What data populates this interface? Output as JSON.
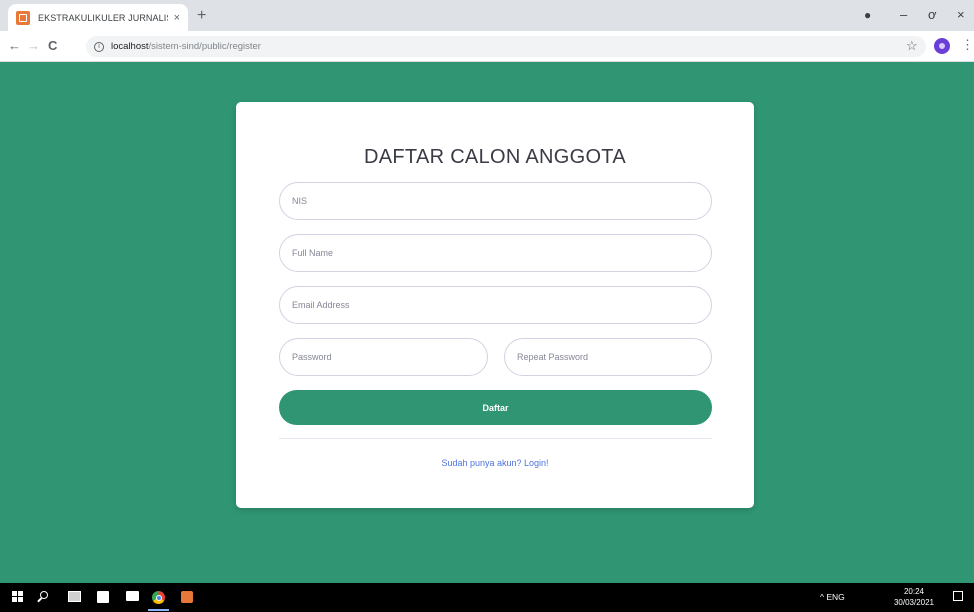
{
  "browser": {
    "tab_title": "EKSTRAKULIKULER JURNALISTIK",
    "tab_close": "×",
    "new_tab": "+",
    "url_host": "localhost",
    "url_path": "/sistem-sind/public/register",
    "window_controls": {
      "minimize": "–",
      "maximize": "ơ",
      "close": "×"
    },
    "nav": {
      "back": "←",
      "forward": "→",
      "reload": "C"
    },
    "star": "☆",
    "menu": "⋮"
  },
  "page": {
    "background_color": "#2f9572",
    "card": {
      "title": "DAFTAR CALON ANGGOTA",
      "fields": {
        "nis_placeholder": "NIS",
        "fullname_placeholder": "Full Name",
        "email_placeholder": "Email Address",
        "password_placeholder": "Password",
        "repeat_password_placeholder": "Repeat Password"
      },
      "submit_label": "Daftar",
      "login_link": "Sudah punya akun? Login!"
    }
  },
  "taskbar": {
    "tray_text": "^  ENG",
    "time": "20:24",
    "date": "30/03/2021"
  }
}
